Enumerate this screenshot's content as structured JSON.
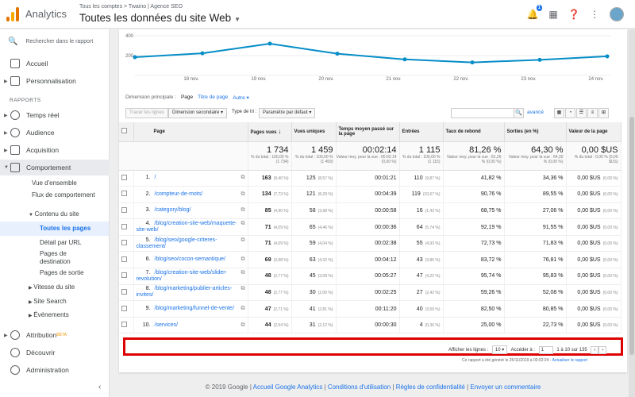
{
  "header": {
    "app_name": "Analytics",
    "account_path": "Tous les comptes > Twaino | Agence SEO",
    "view_title": "Toutes les données du site Web",
    "notification_count": "1"
  },
  "sidebar": {
    "search_placeholder": "Rechercher dans le rapport",
    "home": "Accueil",
    "custom": "Personnalisation",
    "section_reports": "RAPPORTS",
    "realtime": "Temps réel",
    "audience": "Audience",
    "acquisition": "Acquisition",
    "behavior": "Comportement",
    "behavior_sub": {
      "overview": "Vue d'ensemble",
      "flow": "Flux de comportement",
      "site_content": "Contenu du site",
      "all_pages": "Toutes les pages",
      "drilldown": "Détail par URL",
      "landing": "Pages de destination",
      "exit": "Pages de sortie",
      "speed": "Vitesse du site",
      "site_search": "Site Search",
      "events": "Événements"
    },
    "attribution": "Attribution",
    "attribution_badge": "BÊTA",
    "discover": "Découvrir",
    "admin": "Administration"
  },
  "chart_data": {
    "type": "line",
    "x": [
      "18 nov.",
      "19 nov.",
      "20 nov.",
      "21 nov.",
      "22 nov.",
      "23 nov.",
      "24 nov."
    ],
    "y_ticks": [
      "400",
      "200"
    ],
    "series": [
      {
        "values": [
          245,
          290,
          400,
          285,
          220,
          185,
          215,
          255
        ]
      }
    ],
    "color": "#058dc7"
  },
  "toolbar": {
    "primary_dim_label": "Dimension principale :",
    "primary_dim_active": "Page",
    "primary_dim_alt": "Titre de page",
    "primary_dim_other": "Autre",
    "plot_rows": "Tracer les lignes",
    "secondary_dim": "Dimension secondaire",
    "sort_type": "Type de tri :",
    "sort_value": "Paramètre par défaut",
    "advanced": "avancé"
  },
  "table": {
    "headers": [
      "Page",
      "Pages vues",
      "Vues uniques",
      "Temps moyen passé sur la page",
      "Entrées",
      "Taux de rebond",
      "Sorties (en %)",
      "Valeur de la page"
    ],
    "totals": [
      {
        "value": "1 734",
        "sub": "% du total : 100,00 % (1 734)"
      },
      {
        "value": "1 459",
        "sub": "% du total : 100,00 % (1 459)"
      },
      {
        "value": "00:02:14",
        "sub": "Valeur moy. pour la vue : 00:02:14 (0,00 %)"
      },
      {
        "value": "1 115",
        "sub": "% du total : 100,00 % (1 115)"
      },
      {
        "value": "81,26 %",
        "sub": "Valeur moy. pour la vue : 81,26 % (0,00 %)"
      },
      {
        "value": "64,30 %",
        "sub": "Valeur moy. pour la vue : 64,30 % (0,00 %)"
      },
      {
        "value": "0,00 $US",
        "sub": "% du total : 0,00 % (0,00 $US)"
      }
    ],
    "rows": [
      {
        "idx": "1.",
        "page": "/",
        "pv": "163",
        "pv_pct": "(9,40 %)",
        "uv": "125",
        "uv_pct": "(8,57 %)",
        "time": "00:01:21",
        "ent": "110",
        "ent_pct": "(9,87 %)",
        "bounce": "41,82 %",
        "exit": "34,36 %",
        "val": "0,00 $US",
        "val_pct": "(0,00 %)"
      },
      {
        "idx": "2.",
        "page": "/compteur-de-mots/",
        "pv": "134",
        "pv_pct": "(7,73 %)",
        "uv": "121",
        "uv_pct": "(8,29 %)",
        "time": "00:04:39",
        "ent": "119",
        "ent_pct": "(10,67 %)",
        "bounce": "90,76 %",
        "exit": "89,55 %",
        "val": "0,00 $US",
        "val_pct": "(0,00 %)"
      },
      {
        "idx": "3.",
        "page": "/category/blog/",
        "pv": "85",
        "pv_pct": "(4,90 %)",
        "uv": "58",
        "uv_pct": "(3,98 %)",
        "time": "00:00:58",
        "ent": "16",
        "ent_pct": "(1,43 %)",
        "bounce": "68,75 %",
        "exit": "27,06 %",
        "val": "0,00 $US",
        "val_pct": "(0,00 %)"
      },
      {
        "idx": "4.",
        "page": "/blog/creation-site-web/maquette-site-web/",
        "pv": "71",
        "pv_pct": "(4,09 %)",
        "uv": "65",
        "uv_pct": "(4,46 %)",
        "time": "00:00:36",
        "ent": "64",
        "ent_pct": "(5,74 %)",
        "bounce": "92,19 %",
        "exit": "91,55 %",
        "val": "0,00 $US",
        "val_pct": "(0,00 %)"
      },
      {
        "idx": "5.",
        "page": "/blog/seo/google-criteres-classement/",
        "pv": "71",
        "pv_pct": "(4,09 %)",
        "uv": "59",
        "uv_pct": "(4,04 %)",
        "time": "00:02:38",
        "ent": "55",
        "ent_pct": "(4,93 %)",
        "bounce": "72,73 %",
        "exit": "71,83 %",
        "val": "0,00 $US",
        "val_pct": "(0,00 %)"
      },
      {
        "idx": "6.",
        "page": "/blog/seo/cocon-semantique/",
        "pv": "69",
        "pv_pct": "(3,98 %)",
        "uv": "63",
        "uv_pct": "(4,32 %)",
        "time": "00:04:12",
        "ent": "43",
        "ent_pct": "(3,86 %)",
        "bounce": "83,72 %",
        "exit": "76,81 %",
        "val": "0,00 $US",
        "val_pct": "(0,00 %)"
      },
      {
        "idx": "7.",
        "page": "/blog/creation-site-web/slider-revolution/",
        "pv": "48",
        "pv_pct": "(2,77 %)",
        "uv": "45",
        "uv_pct": "(3,08 %)",
        "time": "00:05:27",
        "ent": "47",
        "ent_pct": "(4,22 %)",
        "bounce": "95,74 %",
        "exit": "95,83 %",
        "val": "0,00 $US",
        "val_pct": "(0,00 %)"
      },
      {
        "idx": "8.",
        "page": "/blog/marketing/publier-articles-invites/",
        "pv": "48",
        "pv_pct": "(2,77 %)",
        "uv": "30",
        "uv_pct": "(2,06 %)",
        "time": "00:02:25",
        "ent": "27",
        "ent_pct": "(2,42 %)",
        "bounce": "59,26 %",
        "exit": "52,08 %",
        "val": "0,00 $US",
        "val_pct": "(0,00 %)"
      },
      {
        "idx": "9.",
        "page": "/blog/marketing/funnel-de-vente/",
        "pv": "47",
        "pv_pct": "(2,71 %)",
        "uv": "41",
        "uv_pct": "(2,81 %)",
        "time": "00:11:20",
        "ent": "40",
        "ent_pct": "(3,59 %)",
        "bounce": "82,50 %",
        "exit": "80,85 %",
        "val": "0,00 $US",
        "val_pct": "(0,00 %)"
      },
      {
        "idx": "10.",
        "page": "/services/",
        "pv": "44",
        "pv_pct": "(2,54 %)",
        "uv": "31",
        "uv_pct": "(2,12 %)",
        "time": "00:00:30",
        "ent": "4",
        "ent_pct": "(0,36 %)",
        "bounce": "25,00 %",
        "exit": "22,73 %",
        "val": "0,00 $US",
        "val_pct": "(0,00 %)"
      }
    ]
  },
  "pager": {
    "rows_label": "Afficher les lignes :",
    "rows_value": "10",
    "goto_label": "Accéder à :",
    "goto_value": "1",
    "range": "1 à 10 sur 135"
  },
  "generated": {
    "text": "Ce rapport a été généré le 25/11/2019 à 00:02:24 -",
    "link": "Actualiser le rapport"
  },
  "footer": {
    "copyright": "© 2019 Google |",
    "links": [
      "Accueil Google Analytics",
      "Conditions d'utilisation",
      "Règles de confidentialité",
      "Envoyer un commentaire"
    ]
  }
}
